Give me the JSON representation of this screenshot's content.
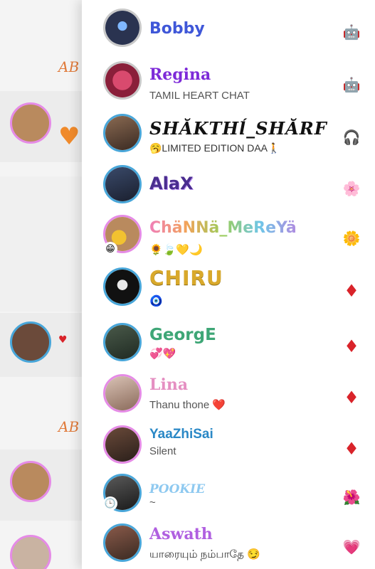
{
  "background": {
    "tag_text": "AB",
    "rows": [
      {
        "type": "tag"
      },
      {
        "type": "post"
      },
      {
        "type": "post"
      },
      {
        "type": "post"
      },
      {
        "type": "tag"
      },
      {
        "type": "post"
      },
      {
        "type": "post"
      }
    ]
  },
  "contacts": [
    {
      "name": "Bobby",
      "subtitle": "",
      "badge_icon": "robot-icon",
      "badge_glyph": "🤖"
    },
    {
      "name": "Regina",
      "subtitle": "TAMIL HEART CHAT",
      "badge_icon": "robot-icon",
      "badge_glyph": "🤖"
    },
    {
      "name": "SHĂKTHĺ_SHĂRF",
      "subtitle": "🥱LIMITED EDITION DAA🚶",
      "badge_icon": "headphones-emoji-icon",
      "badge_glyph": "🎧"
    },
    {
      "name": "AlaX",
      "subtitle": "",
      "badge_icon": "flower-icon",
      "badge_glyph": "🌸"
    },
    {
      "name": "ChäNNä_MeReYä",
      "subtitle": "🌻🍃💛🌙",
      "badge_icon": "flower-icon",
      "badge_glyph": "🌼"
    },
    {
      "name": "CHIRU",
      "subtitle": "🧿",
      "badge_icon": "ruby-icon",
      "badge_glyph": "♦"
    },
    {
      "name": "GeorgE",
      "subtitle": "💞💖",
      "badge_icon": "ruby-icon",
      "badge_glyph": "♦"
    },
    {
      "name": "Lina",
      "subtitle": "Thanu thone ❤️",
      "badge_icon": "ruby-icon",
      "badge_glyph": "♦"
    },
    {
      "name": "YaaZhiSai",
      "subtitle": "Silent",
      "badge_icon": "ruby-icon",
      "badge_glyph": "♦"
    },
    {
      "name": "POOKIE",
      "subtitle": "~",
      "badge_icon": "flower-icon",
      "badge_glyph": "🌺"
    },
    {
      "name": "Aswath",
      "subtitle": "யாரையும் நம்பாதே 😏",
      "badge_icon": "heart-icon",
      "badge_glyph": "💗"
    }
  ],
  "colors": {
    "avatar_ring_blue": "#48a6d9",
    "avatar_ring_pink": "#e58be6",
    "ruby_red": "#d9232a"
  }
}
